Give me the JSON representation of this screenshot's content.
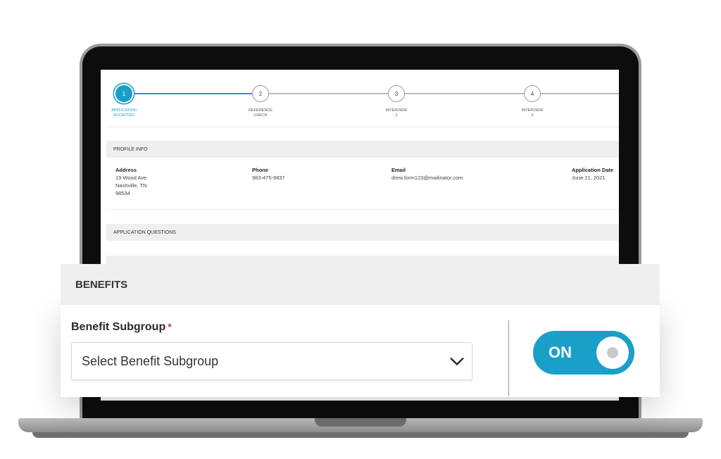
{
  "stepper": {
    "steps": [
      {
        "number": "1",
        "label_line1": "APPLICATION",
        "label_line2": "ACCEPTED"
      },
      {
        "number": "2",
        "label_line1": "REFERENCE",
        "label_line2": "CHECK"
      },
      {
        "number": "3",
        "label_line1": "INTERVIEW",
        "label_line2": "1"
      },
      {
        "number": "4",
        "label_line1": "INTERVIEW",
        "label_line2": "2"
      }
    ]
  },
  "profile": {
    "section_title": "PROFILE INFO",
    "address_label": "Address",
    "address_line1": "19 Wood Ave",
    "address_line2": "Nashville, TN",
    "address_line3": "98534",
    "phone_label": "Phone",
    "phone_value": "983-475-9837",
    "email_label": "Email",
    "email_value": "drew.form123@mailinator.com",
    "date_label": "Application Date",
    "date_value": "June 21, 2021"
  },
  "questions": {
    "section_title": "APPLICATION QUESTIONS"
  },
  "benefits": {
    "title": "BENEFITS",
    "field_label": "Benefit Subgroup",
    "required_mark": "*",
    "select_placeholder": "Select Benefit Subgroup",
    "toggle_label": "ON"
  },
  "colors": {
    "accent": "#1a9fc9",
    "required": "#e03030"
  },
  "icons": {
    "dropdown": "chevron-down-icon"
  }
}
